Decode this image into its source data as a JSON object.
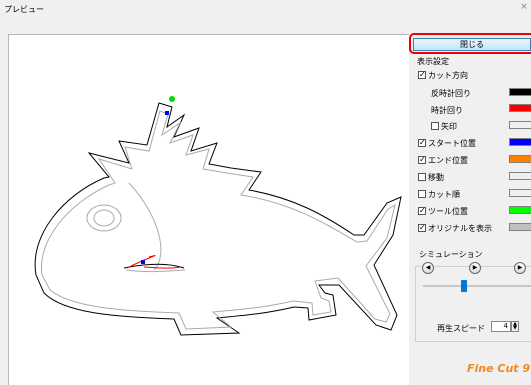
{
  "window": {
    "title": "プレビュー",
    "close_glyph": "×"
  },
  "panel": {
    "close_label": "閉じる",
    "display_settings": "表示設定",
    "items": [
      {
        "label": "カット方向",
        "checked": true
      },
      {
        "label": "反時計回り",
        "color": "#000000"
      },
      {
        "label": "時計回り",
        "color": "#ff0000"
      },
      {
        "label": "矢印",
        "checked": false,
        "color": "#f0f0f0"
      },
      {
        "label": "スタート位置",
        "checked": true,
        "color": "#0000ff"
      },
      {
        "label": "エンド位置",
        "checked": true,
        "color": "#ff8000"
      },
      {
        "label": "移動",
        "checked": false,
        "color": "#f0f0f0"
      },
      {
        "label": "カット順",
        "checked": false,
        "color": "#f0f0f0"
      },
      {
        "label": "ツール位置",
        "checked": true,
        "color": "#00ff00"
      },
      {
        "label": "オリジナルを表示",
        "checked": true,
        "color": "#c0c0c0"
      }
    ],
    "simulation": {
      "title": "シミュレーション",
      "speed_label": "再生スピード",
      "speed_value": "4",
      "slider_level": 0.35
    },
    "logo_text": "Fine Cut 9"
  },
  "icons": {
    "rewind": "skip-back-icon",
    "play": "play-icon",
    "forward": "skip-forward-icon"
  }
}
